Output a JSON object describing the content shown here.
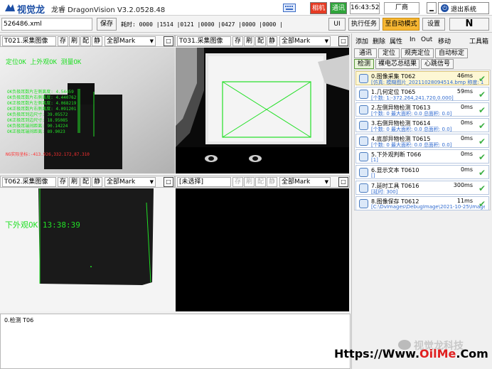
{
  "app": {
    "logo_text": "视觉龙",
    "title": "龙睿 DragonVision V3.2.0528.48"
  },
  "titlebar": {
    "camera_label": "相机",
    "comm_label": "通讯",
    "time": "16:43:52",
    "vendor": "厂商",
    "exit_label": "退出系统",
    "keyboard_icon": "keyboard-icon"
  },
  "toolbar": {
    "file_name": "526486.xml",
    "save_label": "保存",
    "timing_text": "耗时: 0000 |1514 |0121 |0000 |0427 |0000 |0000 |",
    "ui_label": "UI",
    "run_task_label": "执行任务",
    "auto_mode_label": "至自动模式",
    "settings_label": "设置",
    "n_label": "N"
  },
  "panels": [
    {
      "name": "T021.采集图像",
      "sbtns": [
        "存",
        "刷",
        "配",
        "静"
      ],
      "mark": "全部Mark"
    },
    {
      "name": "T031.采集图像",
      "sbtns": [
        "存",
        "刷",
        "配",
        "静"
      ],
      "mark": "全部Mark"
    },
    {
      "name": "T062.采集图像",
      "sbtns": [
        "存",
        "刷",
        "配",
        "静"
      ],
      "mark": "全部Mark"
    },
    {
      "name": "[未选择]",
      "sbtns": [
        "存",
        "刷",
        "配",
        "静"
      ],
      "mark": "全部Mark"
    }
  ],
  "overlay1": {
    "line1": "定位OK     上外观OK  测量OK",
    "rows": [
      "OK负极耳数片左侧离度: 4.54459",
      "OK负极耳数片右侧离度: 4.440762",
      "OK正极耳数片左侧离度: 4.068219",
      "OK正极耳数片右侧离度: 4.091201",
      "OK负极耳到边尺寸: 39.05572",
      "OK正极耳到边尺寸: 18.95085",
      "OK负极耳端间距离: 90.14224",
      "OK正极耳端间距离: 89.9023"
    ],
    "coords": "NG实际坐标:-413.926,332.172,87.310"
  },
  "overlay3": {
    "text": "下外观OK   13:38:39"
  },
  "log": {
    "text": "0.检测 T06"
  },
  "right_panel": {
    "menu": [
      "添加",
      "删除",
      "属性",
      "In",
      "Out",
      "移动",
      "工具箱"
    ],
    "tabs_row1": [
      "通讯",
      "定位",
      "规壳定位",
      "自动标定"
    ],
    "tabs_row2": [
      "检测",
      "裸电芯总结果",
      "心跳信号"
    ],
    "active_tab": "检测"
  },
  "tools": [
    {
      "name": "0.图像采集  T062",
      "time": "46ms",
      "detail": "[仿真: 模糊图片_20211028094514.bmp  称度: 1",
      "check": "✔"
    },
    {
      "name": "1.几何定位  T065",
      "time": "59ms",
      "detail": "[个数: 1:-372.264,241.720,0.000]",
      "check": "✔"
    },
    {
      "name": "2.左侧异物检测  T0613",
      "time": "0ms",
      "detail": "[个数: 0 最大面积: 0.0 总面积: 0.0]",
      "check": "✔"
    },
    {
      "name": "3.右侧异物检测  T0614",
      "time": "0ms",
      "detail": "[个数: 0 最大面积: 0.0 总面积: 0.0]",
      "check": "✔"
    },
    {
      "name": "4.底部异物检测  T0615",
      "time": "0ms",
      "detail": "[个数: 0 最大面积: 0.0 总面积: 0.0]",
      "check": "✔"
    },
    {
      "name": "5.下外观判断  T066",
      "time": "0ms",
      "detail": "[1]",
      "check": "✔"
    },
    {
      "name": "6.显示文本  T0610",
      "time": "0ms",
      "detail": "[]",
      "check": "✔"
    },
    {
      "name": "7.延时工具  T0616",
      "time": "300ms",
      "detail": "[延时: 300]",
      "check": "✔"
    },
    {
      "name": "8.图像保存  T0612",
      "time": "11ms",
      "detail": "[C:\\DvImages\\DebugImage\\2021-10-25\\Image]",
      "check": "✔"
    }
  ],
  "watermark": {
    "line1": "视觉龙科技",
    "line2": "Https://Www.OilMe.Com"
  }
}
